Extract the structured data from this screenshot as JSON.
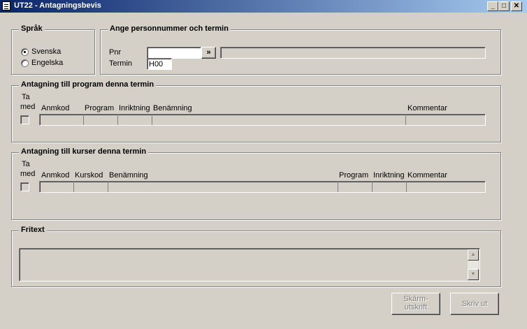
{
  "window": {
    "title": "UT22 - Antagningsbevis",
    "minimize_glyph": "_",
    "maximize_glyph": "□",
    "close_glyph": "✕"
  },
  "language": {
    "legend": "Språk",
    "options": [
      {
        "label": "Svenska",
        "checked": true
      },
      {
        "label": "Engelska",
        "checked": false
      }
    ]
  },
  "person": {
    "legend": "Ange personnummer och termin",
    "pnr_label": "Pnr",
    "pnr_value": "",
    "lookup_button": "»",
    "name_value": "",
    "termin_label": "Termin",
    "termin_value": "H00"
  },
  "program_admission": {
    "legend": "Antagning till program denna termin",
    "take_along_label_1": "Ta",
    "take_along_label_2": "med",
    "columns": [
      "Anmkod",
      "Program",
      "Inriktning",
      "Benämning",
      "Kommentar"
    ]
  },
  "course_admission": {
    "legend": "Antagning till kurser denna termin",
    "take_along_label_1": "Ta",
    "take_along_label_2": "med",
    "columns": [
      "Anmkod",
      "Kurskod",
      "Benämning",
      "Program",
      "Inriktning",
      "Kommentar"
    ]
  },
  "freetext": {
    "legend": "Fritext",
    "value": "",
    "scroll_up": "▲",
    "scroll_down": "▼"
  },
  "actions": {
    "screen_print_line1": "Skärm-",
    "screen_print_line2": "utskrift",
    "print": "Skriv ut"
  }
}
